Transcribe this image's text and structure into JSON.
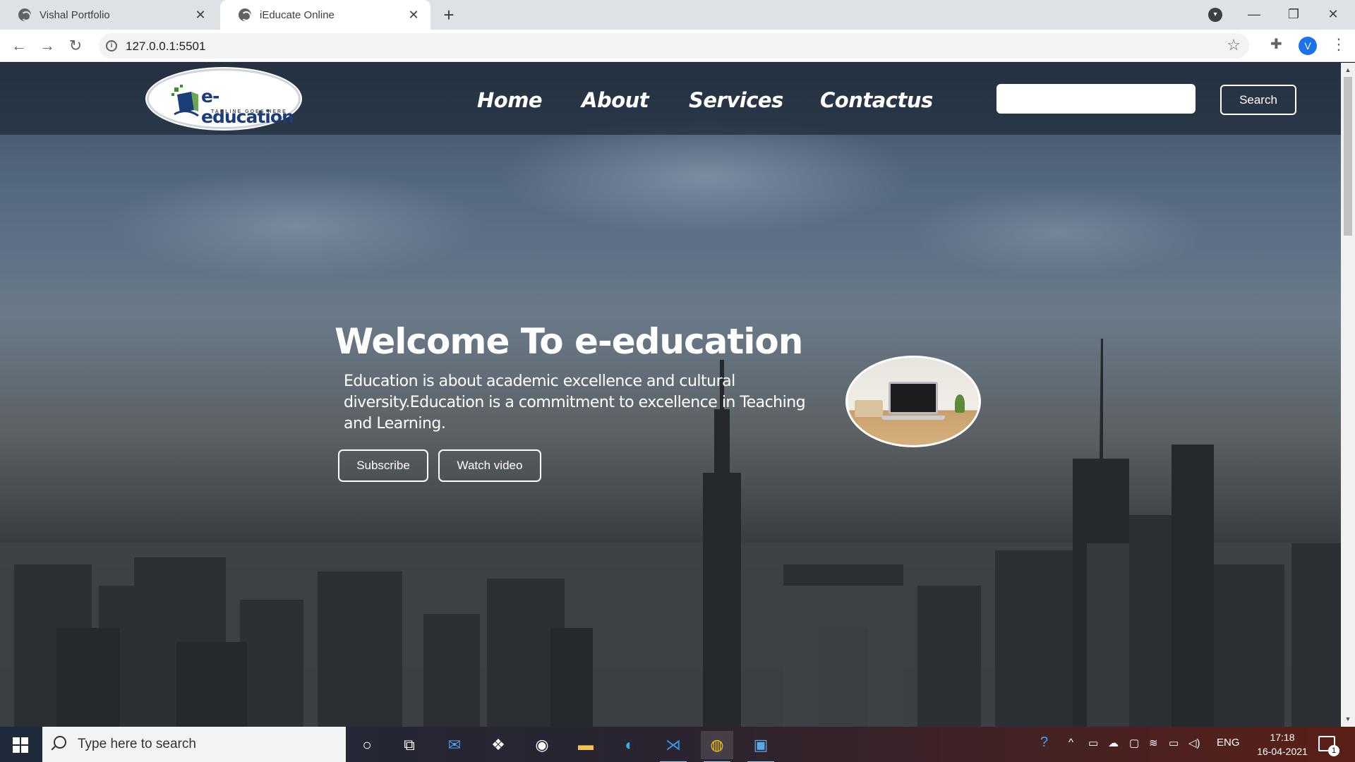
{
  "browser": {
    "tabs": [
      {
        "title": "Vishal Portfolio",
        "active": false
      },
      {
        "title": "iEducate Online",
        "active": true
      }
    ],
    "url": "127.0.0.1:5501",
    "profile_initial": "V"
  },
  "site": {
    "logo": {
      "brand": "e-education",
      "tagline": "TAGLINE GOES HERE"
    },
    "nav": [
      "Home",
      "About",
      "Services",
      "Contactus"
    ],
    "search": {
      "value": "",
      "button_label": "Search"
    },
    "hero": {
      "title": "Welcome To e-education",
      "text": "Education is about academic excellence and cultural diversity.Education is a commitment to excellence in Teaching and Learning.",
      "buttons": [
        "Subscribe",
        "Watch video"
      ]
    }
  },
  "taskbar": {
    "search_placeholder": "Type here to search",
    "language": "ENG",
    "time": "17:18",
    "date": "16-04-2021",
    "notification_count": "1"
  },
  "colors": {
    "nav_overlay": "#161e2c",
    "logo_brand": "#1d3d7a",
    "accent_user": "#1a73e8"
  }
}
